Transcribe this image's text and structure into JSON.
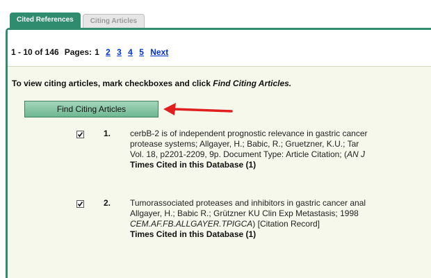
{
  "tabs": {
    "cited_references": "Cited References",
    "citing_articles": "Citing Articles"
  },
  "pager": {
    "range": "1 - 10 of 146",
    "pages_label": "Pages:",
    "current_page": "1",
    "page_links": [
      "2",
      "3",
      "4",
      "5"
    ],
    "next_label": "Next"
  },
  "instruction": {
    "text": "To view citing articles, mark checkboxes and click",
    "emphasis": "Find Citing Articles."
  },
  "find_button": {
    "label": "Find Citing Articles"
  },
  "records": [
    {
      "number": "1.",
      "checked": true,
      "line1": "cerbB-2 is of independent prognostic relevance in gastric cancer",
      "line2": "protease systems; Allgayer, H.; Babic, R.; Gruetzner, K.U.; Tar",
      "line3_pre": "Vol. 18, p2201-2209, 9p. Document Type: Article Citation; (",
      "line3_italic": "AN J",
      "times_cited": "Times Cited in this Database (1)"
    },
    {
      "number": "2.",
      "checked": true,
      "line1": "Tumorassociated proteases and inhibitors in gastric cancer anal",
      "line2": "Allgayer, H.; Babic R.; Grützner KU Clin Exp Metastasis; 1998 ",
      "line3_italic": "CEM.AF.FB.ALLGAYER.TPIGCA",
      "line3_post": ") [Citation Record]",
      "times_cited": "Times Cited in this Database (1)"
    }
  ],
  "colors": {
    "accent_green": "#2f8c6e",
    "panel_bg": "#f5f8ea",
    "link_blue": "#0033cc",
    "arrow_red": "#e02020"
  }
}
